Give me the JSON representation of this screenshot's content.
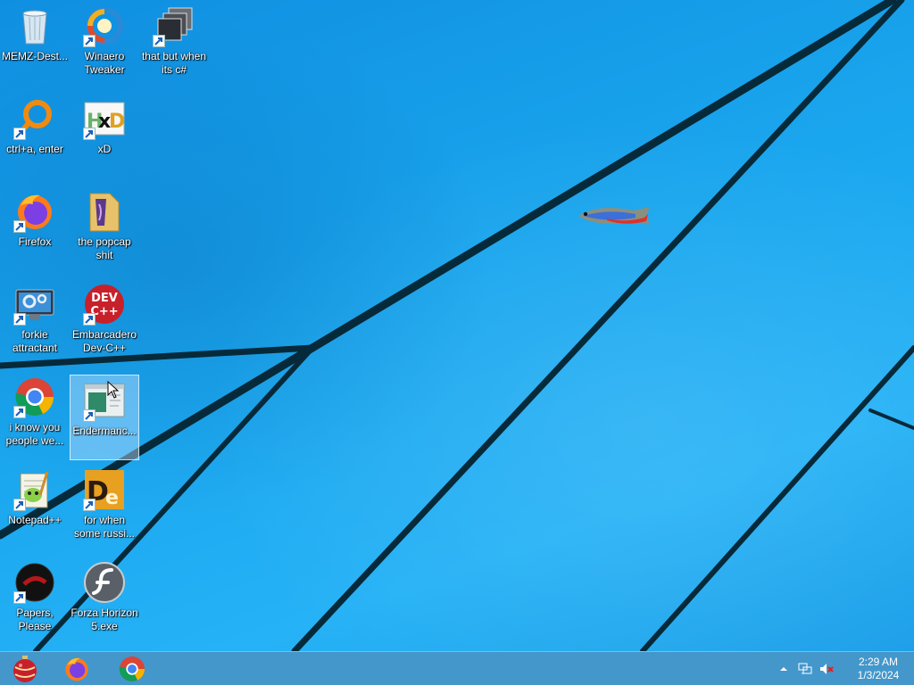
{
  "desktop": {
    "icons": [
      {
        "label": "MEMZ-Dest...",
        "icon": "recycle-bin-icon"
      },
      {
        "label": "Winaero Tweaker",
        "icon": "winaero-tweaker-icon"
      },
      {
        "label": "that but when its c#",
        "icon": "stacked-windows-icon"
      },
      {
        "label": "ctrl+a, enter",
        "icon": "magnifier-ring-icon"
      },
      {
        "label": "xD",
        "icon": "hxd-icon"
      },
      {
        "label": "Firefox",
        "icon": "firefox-icon"
      },
      {
        "label": "the popcap shit",
        "icon": "folder-icon"
      },
      {
        "label": "forkie attractant",
        "icon": "monitor-gears-icon"
      },
      {
        "label": "Embarcadero Dev-C++",
        "icon": "devcpp-icon"
      },
      {
        "label": "i know you people we...",
        "icon": "chrome-icon"
      },
      {
        "label": "Endermanc...",
        "icon": "window-app-icon",
        "selected": true
      },
      {
        "label": "Notepad++",
        "icon": "notepad-plus-plus-icon"
      },
      {
        "label": "for when some russi...",
        "icon": "de-icon"
      },
      {
        "label": "Papers, Please",
        "icon": "papers-please-icon"
      },
      {
        "label": "Forza Horizon 5.exe",
        "icon": "flash-icon"
      }
    ]
  },
  "taskbar": {
    "pinned": [
      {
        "icon": "ornament-start-icon"
      },
      {
        "icon": "firefox-icon"
      },
      {
        "icon": "chrome-icon"
      }
    ],
    "tray": {
      "icons": [
        "chevron-up-icon",
        "network-icon",
        "volume-muted-icon"
      ],
      "time": "2:29 AM",
      "date": "1/3/2024"
    }
  },
  "colors": {
    "wallpaper": "#1aa3ea",
    "taskbar": "#4696c8",
    "selection": "#bee1ff"
  }
}
